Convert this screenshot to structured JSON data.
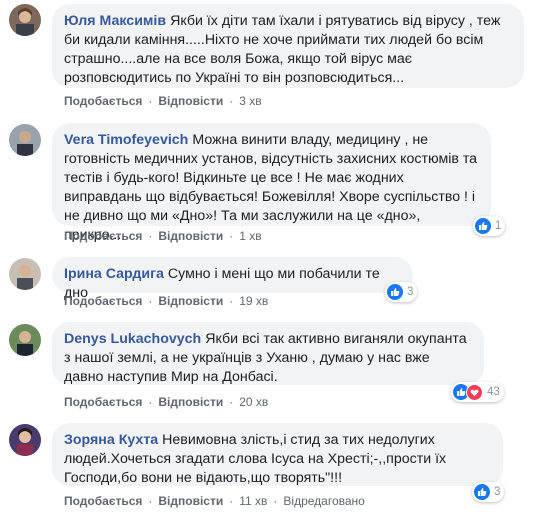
{
  "labels": {
    "like": "Подобається",
    "reply": "Відповісти",
    "hide": "Відредагован"
  },
  "comments": [
    {
      "author": "Юля Максимів",
      "text": "Якби їх діти там їхали і рятуватись від вірусу , теж би кидали каміння.....Ніхто не хоче приймати тих людей бо всім страшно....але на все воля Божа, якщо той вірус має розповсюдитись по Україні то він розповсюдиться...",
      "time": "3 хв",
      "reactions": null
    },
    {
      "author": "Vera Timofeyevich",
      "text": "Можна винити владу, медицину , не готовність медичних установ, відсутність захисних костюмів та тестів і будь-кого! Відкиньте це все ! Не має жодних виправдань що відбувається! Божевілля! Хворе суспільство ! і не дивно що ми «Дно»! Та ми заслужили на це «дно», прикро....",
      "time": "1 хв",
      "reactions": "1"
    },
    {
      "author": "Ірина Сардига",
      "text": "Сумно і мені що ми побачили те дно",
      "time": "19 хв",
      "reactions": "3"
    },
    {
      "author": "Denys Lukachovych",
      "text": "Якби всі так активно виганяли окупанта з нашої землі, а не українців з Уханю , думаю у нас вже давно наступив Мир на Донбасі.",
      "time": "20 хв",
      "reactions": "43"
    },
    {
      "author": "Зоряна Кухта",
      "text": "Невимовна злість,і стид за тих недолугих людей.Хочеться згадати слова Ісуса на Хресті;-,,прости їх Господи,бо вони не відають,що творять\"!!!",
      "time": "11 хв",
      "reactions": "3",
      "extra": "Відредаговано"
    }
  ],
  "colors": {
    "author": "#385898",
    "bubble": "#f2f3f5",
    "meta": "#606770",
    "like": "#1877f2",
    "love": "#f33e58"
  }
}
